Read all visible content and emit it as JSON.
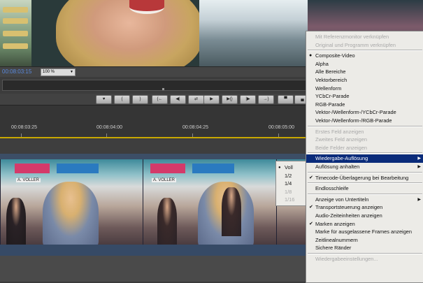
{
  "status_bar": {
    "timecode": "00:08:03:15",
    "zoom": "100 %"
  },
  "transport_buttons": [
    {
      "icon": "marker-icon",
      "glyph": "♥"
    },
    {
      "icon": "in-point-icon",
      "glyph": "{"
    },
    {
      "icon": "out-point-icon",
      "glyph": "}"
    },
    {
      "icon": "go-to-in-icon",
      "glyph": "{←"
    },
    {
      "icon": "step-back-icon",
      "glyph": "◀|"
    },
    {
      "icon": "loop-icon",
      "glyph": "⇄"
    },
    {
      "icon": "play-icon",
      "glyph": "▶"
    },
    {
      "icon": "play-in-to-out-icon",
      "glyph": "▶{}"
    },
    {
      "icon": "step-forward-icon",
      "glyph": "|▶"
    },
    {
      "icon": "go-to-out-icon",
      "glyph": "→}"
    },
    {
      "icon": "lift-icon",
      "glyph": "▀"
    },
    {
      "icon": "extract-icon",
      "glyph": "▄"
    }
  ],
  "ruler": {
    "labels": [
      "00:08:03:25",
      "00:08:04:00",
      "00:08:04:25",
      "00:08:05:00"
    ]
  },
  "context_menu": {
    "items": [
      {
        "label": "Mit Referenzmonitor verknüpfen",
        "disabled": true
      },
      {
        "label": "Original und Programm verknüpfen",
        "disabled": true
      },
      {
        "separator": true
      },
      {
        "label": "Composite-Video",
        "mark": "dot"
      },
      {
        "label": "Alpha"
      },
      {
        "label": "Alle Bereiche"
      },
      {
        "label": "Vektorbereich"
      },
      {
        "label": "Wellenform"
      },
      {
        "label": "YCbCr-Parade"
      },
      {
        "label": "RGB-Parade"
      },
      {
        "label": "Vektor-/Wellenform-/YCbCr-Parade"
      },
      {
        "label": "Vektor-/Wellenform-/RGB-Parade"
      },
      {
        "separator": true
      },
      {
        "label": "Erstes Feld anzeigen",
        "disabled": true
      },
      {
        "label": "Zweites Feld anzeigen",
        "disabled": true
      },
      {
        "label": "Beide Felder anzeigen",
        "disabled": true
      },
      {
        "separator": true
      },
      {
        "label": "Wiedergabe-Auflösung",
        "submenu": true,
        "selected": true
      },
      {
        "label": "Auflösung anhalten",
        "submenu": true
      },
      {
        "separator": true
      },
      {
        "label": "Timecode-Überlagerung bei Bearbeitung",
        "mark": "check"
      },
      {
        "separator": true
      },
      {
        "label": "Endlosschleife"
      },
      {
        "separator": true
      },
      {
        "label": "Anzeige von Untertiteln",
        "submenu": true
      },
      {
        "label": "Transportsteuerung anzeigen",
        "mark": "check"
      },
      {
        "label": "Audio-Zeiteinheiten anzeigen"
      },
      {
        "label": "Marken anzeigen",
        "mark": "check"
      },
      {
        "label": "Marke für ausgelassene Frames anzeigen"
      },
      {
        "label": "Zeitlinealnummern"
      },
      {
        "label": "Sichere Ränder"
      },
      {
        "separator": true
      },
      {
        "label": "Wiedergabeeinstellungen...",
        "disabled": true
      }
    ]
  },
  "resolution_submenu": {
    "items": [
      {
        "label": "Voll",
        "mark": "dot"
      },
      {
        "label": "1/2"
      },
      {
        "label": "1/4"
      },
      {
        "label": "1/8",
        "disabled": true
      },
      {
        "label": "1/16",
        "disabled": true
      }
    ]
  },
  "clip_signs": [
    "A. VOLLER",
    "A. VOLLER"
  ]
}
